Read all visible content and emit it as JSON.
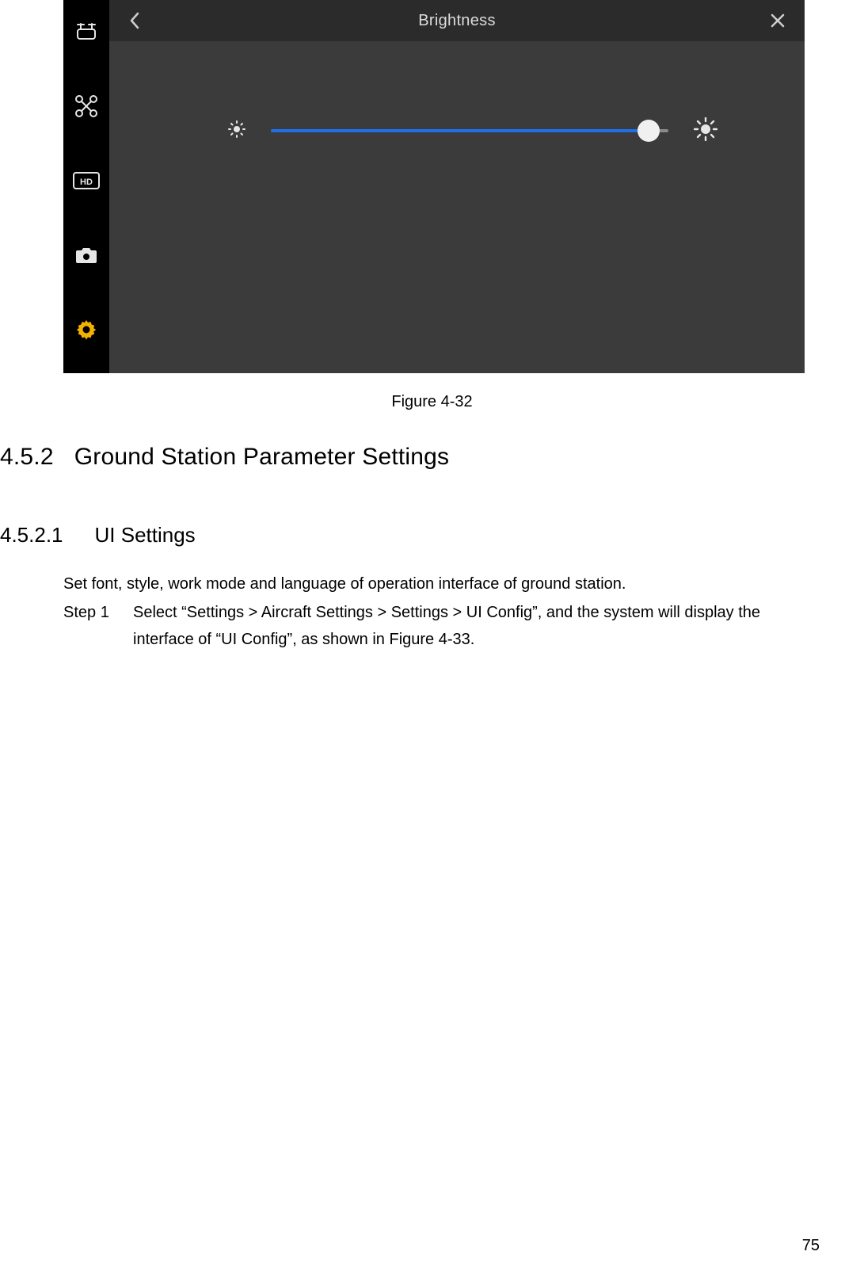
{
  "screenshot": {
    "header": {
      "title": "Brightness"
    },
    "slider": {
      "value_pct": 95
    },
    "sidebar": {
      "items": [
        {
          "name": "remote-icon",
          "active": false
        },
        {
          "name": "drone-icon",
          "active": false
        },
        {
          "name": "hd-icon",
          "active": false
        },
        {
          "name": "camera-icon",
          "active": false
        },
        {
          "name": "gear-icon",
          "active": true
        }
      ]
    }
  },
  "caption": "Figure 4-32",
  "sections": {
    "h2_num": "4.5.2",
    "h2_title": "Ground Station Parameter Settings",
    "h3_num": "4.5.2.1",
    "h3_title": "UI Settings",
    "intro": "Set font, style, work mode and language of operation interface of ground station.",
    "step_label": "Step 1",
    "step_text": "Select “Settings > Aircraft Settings > Settings > UI Config”, and the system will display the interface of “UI Config”, as shown in Figure 4-33."
  },
  "page_number": "75"
}
